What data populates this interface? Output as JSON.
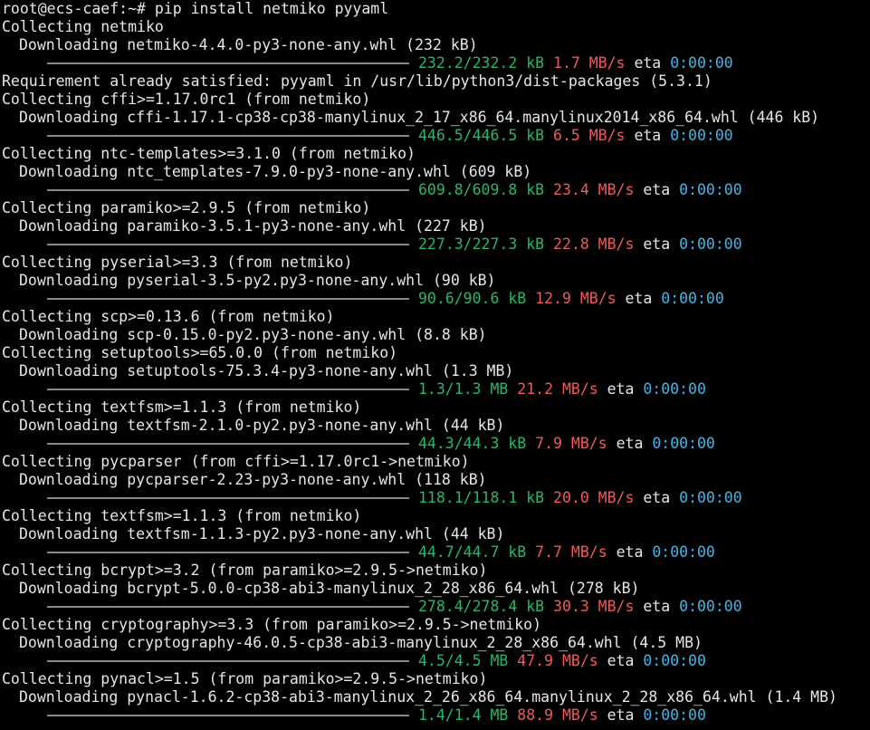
{
  "terminal": {
    "prompt": "root@ecs-caef:~#",
    "command": "pip install netmiko pyyaml",
    "eta_label": "eta",
    "blocks": [
      {
        "collect": "Collecting netmiko",
        "download": "Downloading netmiko-4.4.0-py3-none-any.whl (232 kB)",
        "size": "232.2/232.2 kB",
        "rate": "1.7 MB/s",
        "eta": "0:00:00",
        "progress": 1.0
      },
      {
        "satisfied": "Requirement already satisfied: pyyaml in /usr/lib/python3/dist-packages (5.3.1)"
      },
      {
        "collect": "Collecting cffi>=1.17.0rc1 (from netmiko)",
        "download": "Downloading cffi-1.17.1-cp38-cp38-manylinux_2_17_x86_64.manylinux2014_x86_64.whl (446 kB)",
        "size": "446.5/446.5 kB",
        "rate": "6.5 MB/s",
        "eta": "0:00:00",
        "progress": 1.0
      },
      {
        "collect": "Collecting ntc-templates>=3.1.0 (from netmiko)",
        "download": "Downloading ntc_templates-7.9.0-py3-none-any.whl (609 kB)",
        "size": "609.8/609.8 kB",
        "rate": "23.4 MB/s",
        "eta": "0:00:00",
        "progress": 1.0
      },
      {
        "collect": "Collecting paramiko>=2.9.5 (from netmiko)",
        "download": "Downloading paramiko-3.5.1-py3-none-any.whl (227 kB)",
        "size": "227.3/227.3 kB",
        "rate": "22.8 MB/s",
        "eta": "0:00:00",
        "progress": 1.0
      },
      {
        "collect": "Collecting pyserial>=3.3 (from netmiko)",
        "download": "Downloading pyserial-3.5-py2.py3-none-any.whl (90 kB)",
        "size": "90.6/90.6 kB",
        "rate": "12.9 MB/s",
        "eta": "0:00:00",
        "progress": 1.0
      },
      {
        "collect": "Collecting scp>=0.13.6 (from netmiko)",
        "download": "Downloading scp-0.15.0-py2.py3-none-any.whl (8.8 kB)"
      },
      {
        "collect": "Collecting setuptools>=65.0.0 (from netmiko)",
        "download": "Downloading setuptools-75.3.4-py3-none-any.whl (1.3 MB)",
        "size": "1.3/1.3 MB",
        "rate": "21.2 MB/s",
        "eta": "0:00:00",
        "progress": 1.0
      },
      {
        "collect": "Collecting textfsm>=1.1.3 (from netmiko)",
        "download": "Downloading textfsm-2.1.0-py2.py3-none-any.whl (44 kB)",
        "size": "44.3/44.3 kB",
        "rate": "7.9 MB/s",
        "eta": "0:00:00",
        "progress": 1.0
      },
      {
        "collect": "Collecting pycparser (from cffi>=1.17.0rc1->netmiko)",
        "download": "Downloading pycparser-2.23-py3-none-any.whl (118 kB)",
        "size": "118.1/118.1 kB",
        "rate": "20.0 MB/s",
        "eta": "0:00:00",
        "progress": 1.0
      },
      {
        "collect": "Collecting textfsm>=1.1.3 (from netmiko)",
        "download": "Downloading textfsm-1.1.3-py2.py3-none-any.whl (44 kB)",
        "size": "44.7/44.7 kB",
        "rate": "7.7 MB/s",
        "eta": "0:00:00",
        "progress": 1.0
      },
      {
        "collect": "Collecting bcrypt>=3.2 (from paramiko>=2.9.5->netmiko)",
        "download": "Downloading bcrypt-5.0.0-cp38-abi3-manylinux_2_28_x86_64.whl (278 kB)",
        "size": "278.4/278.4 kB",
        "rate": "30.3 MB/s",
        "eta": "0:00:00",
        "progress": 1.0
      },
      {
        "collect": "Collecting cryptography>=3.3 (from paramiko>=2.9.5->netmiko)",
        "download": "Downloading cryptography-46.0.5-cp38-abi3-manylinux_2_28_x86_64.whl (4.5 MB)",
        "size": "4.5/4.5 MB",
        "rate": "47.9 MB/s",
        "eta": "0:00:00",
        "progress": 1.0
      },
      {
        "collect": "Collecting pynacl>=1.5 (from paramiko>=2.9.5->netmiko)",
        "download": "Downloading pynacl-1.6.2-cp38-abi3-manylinux_2_26_x86_64.manylinux_2_28_x86_64.whl (1.4 MB)",
        "size": "1.4/1.4 MB",
        "rate": "88.9 MB/s",
        "eta": "0:00:00",
        "progress": 1.0
      }
    ]
  },
  "colors": {
    "background": "#000000",
    "text": "#e6e6e6",
    "size": "#23b96a",
    "rate": "#f05a5a",
    "eta": "#3fb6e8",
    "bar": "#8a8a8a"
  }
}
